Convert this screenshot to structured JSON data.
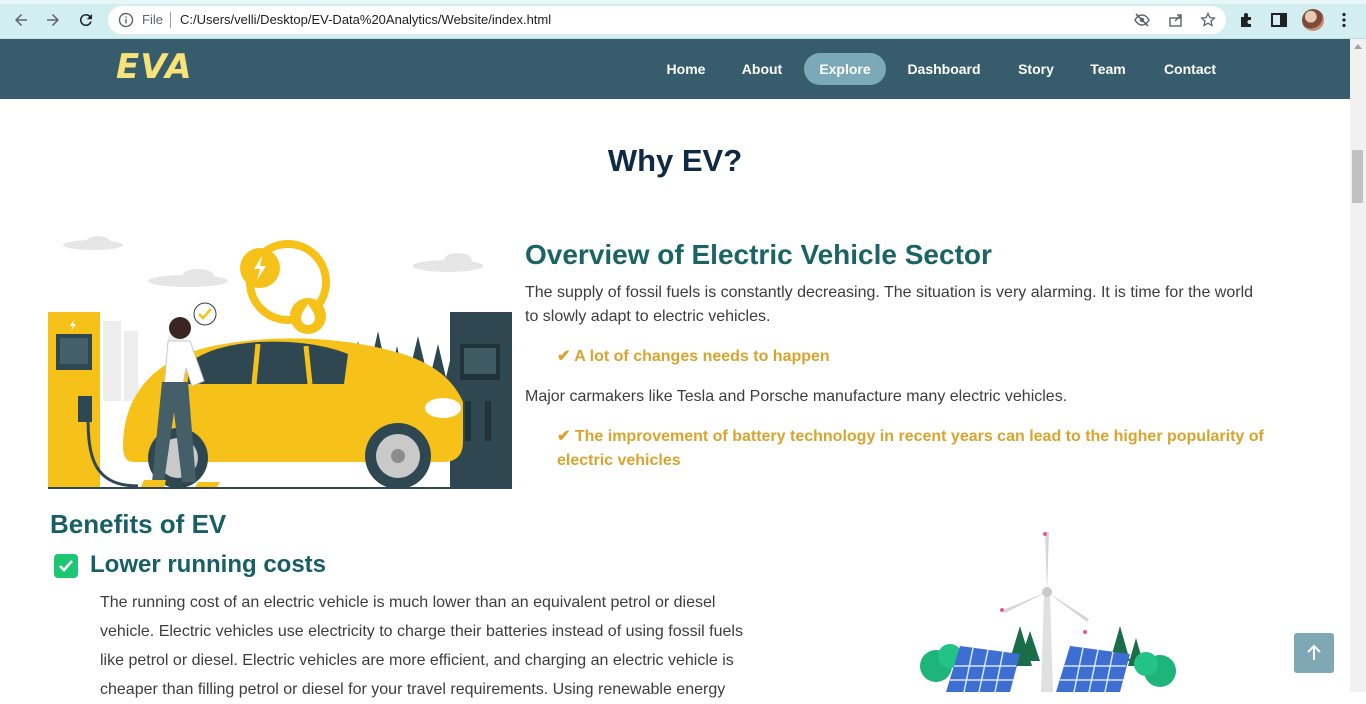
{
  "browser": {
    "protocol_label": "File",
    "url": "C:/Users/velli/Desktop/EV-Data%20Analytics/Website/index.html"
  },
  "site": {
    "logo": "EVA",
    "nav": [
      {
        "label": "Home"
      },
      {
        "label": "About"
      },
      {
        "label": "Explore",
        "active": true
      },
      {
        "label": "Dashboard"
      },
      {
        "label": "Story"
      },
      {
        "label": "Team"
      },
      {
        "label": "Contact"
      }
    ]
  },
  "main": {
    "title": "Why EV?",
    "overview": {
      "title": "Overview of Electric Vehicle Sector",
      "para1_line1": "The supply of fossil fuels is constantly decreasing. The situation is very alarming. It is time for the world",
      "para1_line2": "to slowly adapt to electric vehicles.",
      "highlight1": "✔ A lot of changes needs to happen",
      "para2": "Major carmakers like Tesla and Porsche manufacture many electric vehicles.",
      "highlight2_line1": "✔ The improvement of battery technology in recent years can lead to the higher popularity of",
      "highlight2_line2": "electric vehicles"
    },
    "benefits": {
      "title": "Benefits of EV",
      "item1": {
        "title": "Lower running costs",
        "lines": [
          "The running cost of an electric vehicle is much lower than an equivalent petrol or diesel",
          "vehicle. Electric vehicles use electricity to charge their batteries instead of using fossil fuels",
          "like petrol or diesel. Electric vehicles are more efficient, and charging an electric vehicle is",
          "cheaper than filling petrol or diesel for your travel requirements. Using renewable energy"
        ]
      }
    }
  },
  "colors": {
    "header_bg": "#375d6c",
    "logo": "#f9e27a",
    "nav_active": "#7ba9b7",
    "heading_teal": "#1a6466",
    "highlight_gold": "#d9a42d",
    "check_green": "#1cc673"
  },
  "icons": [
    "back-icon",
    "forward-icon",
    "reload-icon",
    "info-icon",
    "eye-off-icon",
    "share-icon",
    "star-icon",
    "extensions-icon",
    "sidebar-icon",
    "menu-icon",
    "check-icon",
    "arrow-up-icon"
  ]
}
